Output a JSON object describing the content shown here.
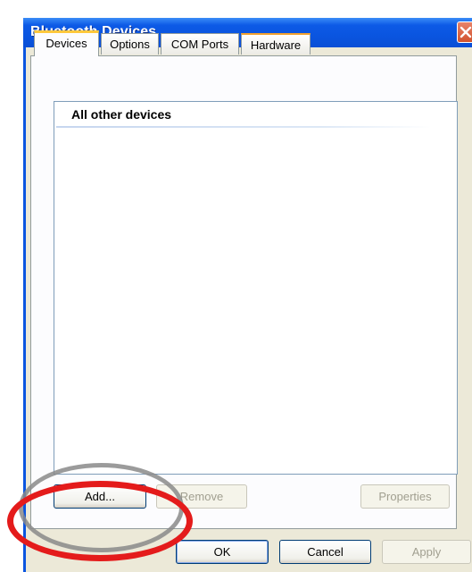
{
  "window": {
    "title": "Bluetooth Devices"
  },
  "tabs": [
    {
      "label": "Devices",
      "active": true
    },
    {
      "label": "Options",
      "active": false
    },
    {
      "label": "COM Ports",
      "active": false
    },
    {
      "label": "Hardware",
      "active": false
    }
  ],
  "device_list": {
    "group_header": "All other devices"
  },
  "panel_buttons": {
    "add": "Add...",
    "remove": "Remove",
    "properties": "Properties"
  },
  "dialog_buttons": {
    "ok": "OK",
    "cancel": "Cancel",
    "apply": "Apply"
  },
  "colors": {
    "titlebar": "#0a55e0",
    "annotation_ring": "#e41b1b",
    "active_tab_accent": "#ffc83c"
  }
}
